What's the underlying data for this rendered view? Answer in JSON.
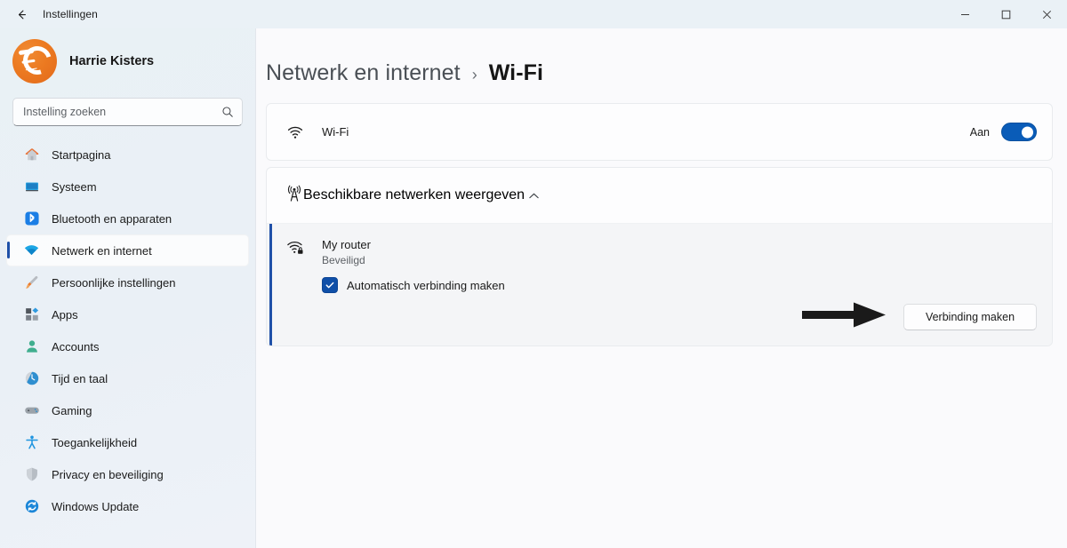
{
  "titlebar": {
    "back_icon": "back-arrow-icon",
    "title": "Instellingen",
    "minimize_label": "–",
    "maximize_label": "□",
    "close_label": "✕"
  },
  "sidebar": {
    "profile": {
      "name": "Harrie Kisters",
      "avatar_icon": "user-avatar-logo"
    },
    "search": {
      "placeholder": "Instelling zoeken",
      "value": "",
      "icon": "search-icon"
    },
    "items": [
      {
        "label": "Startpagina",
        "icon": "home-icon",
        "selected": false
      },
      {
        "label": "Systeem",
        "icon": "monitor-icon",
        "selected": false
      },
      {
        "label": "Bluetooth en apparaten",
        "icon": "bluetooth-icon",
        "selected": false
      },
      {
        "label": "Netwerk en internet",
        "icon": "wifi-icon",
        "selected": true
      },
      {
        "label": "Persoonlijke instellingen",
        "icon": "paintbrush-icon",
        "selected": false
      },
      {
        "label": "Apps",
        "icon": "apps-grid-icon",
        "selected": false
      },
      {
        "label": "Accounts",
        "icon": "person-icon",
        "selected": false
      },
      {
        "label": "Tijd en taal",
        "icon": "clock-icon",
        "selected": false
      },
      {
        "label": "Gaming",
        "icon": "gamepad-icon",
        "selected": false
      },
      {
        "label": "Toegankelijkheid",
        "icon": "accessibility-icon",
        "selected": false
      },
      {
        "label": "Privacy en beveiliging",
        "icon": "shield-icon",
        "selected": false
      },
      {
        "label": "Windows Update",
        "icon": "update-refresh-icon",
        "selected": false
      }
    ]
  },
  "breadcrumb": {
    "parent": "Netwerk en internet",
    "separator": "›",
    "current": "Wi-Fi"
  },
  "wifi_card": {
    "icon": "wifi-icon",
    "label": "Wi-Fi",
    "toggle_state": "Aan",
    "toggle_on": true
  },
  "networks_card": {
    "icon": "broadcast-tower-icon",
    "label": "Beschikbare netwerken weergeven",
    "expanded": true,
    "chevron_icon": "chevron-up-icon",
    "networks": [
      {
        "icon": "wifi-secured-icon",
        "name": "My router",
        "security": "Beveiligd",
        "auto_connect_label": "Automatisch verbinding maken",
        "auto_connect_checked": true,
        "connect_button": "Verbinding maken",
        "selected": true
      }
    ]
  },
  "annotation": {
    "arrow_icon": "pointing-arrow-icon"
  },
  "colors": {
    "accent_blue": "#0a5cb8",
    "selection_bar": "#1f50a8",
    "checkbox_blue": "#0f4fa8",
    "sidebar_bg": "#eaf1f6",
    "content_bg": "#fafafc",
    "avatar_orange": "#ec7a21"
  }
}
